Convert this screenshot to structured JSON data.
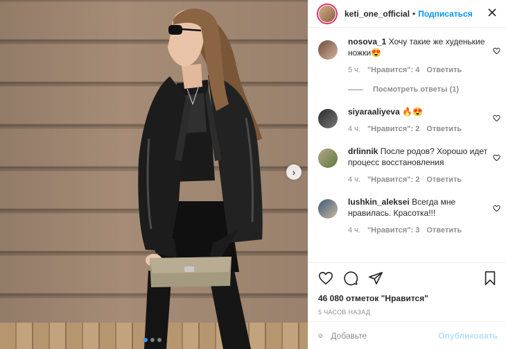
{
  "post": {
    "author": "keti_one_official",
    "separator": "•",
    "follow_label": "Подписаться",
    "more_icon": "more-horizontal-icon",
    "carousel_next_icon": "chevron-right-icon"
  },
  "comments": [
    {
      "username": "nosova_1",
      "text": "Хочу такие же худенькие ножки😍",
      "time": "5 ч.",
      "likes": "\"Нравится\": 4",
      "reply": "Ответить",
      "view_replies": "Посмотреть ответы (1)"
    },
    {
      "username": "siyaraaliyeva",
      "text": "🔥😍",
      "time": "4 ч.",
      "likes": "\"Нравится\": 2",
      "reply": "Ответить"
    },
    {
      "username": "drlinnik",
      "text": "После родов? Хорошо идет процесс восстановления",
      "time": "4 ч.",
      "likes": "\"Нравится\": 2",
      "reply": "Ответить"
    },
    {
      "username": "lushkin_aleksei",
      "text": "Всегда мне нравилась. Красотка!!!",
      "time": "4 ч.",
      "likes": "\"Нравится\": 3",
      "reply": "Ответить"
    }
  ],
  "actions": {
    "likes_count": "46 080 отметок \"Нравится\"",
    "posted_time": "5 ЧАСОВ НАЗАД"
  },
  "add_comment": {
    "placeholder": "Добавьте комментарий...",
    "display": "Добавьте",
    "publish_label": "Опубликовать"
  },
  "colors": {
    "accent": "#0095f6",
    "publish_disabled": "#b2dffc",
    "muted": "#8e8e8e",
    "text": "#262626"
  }
}
